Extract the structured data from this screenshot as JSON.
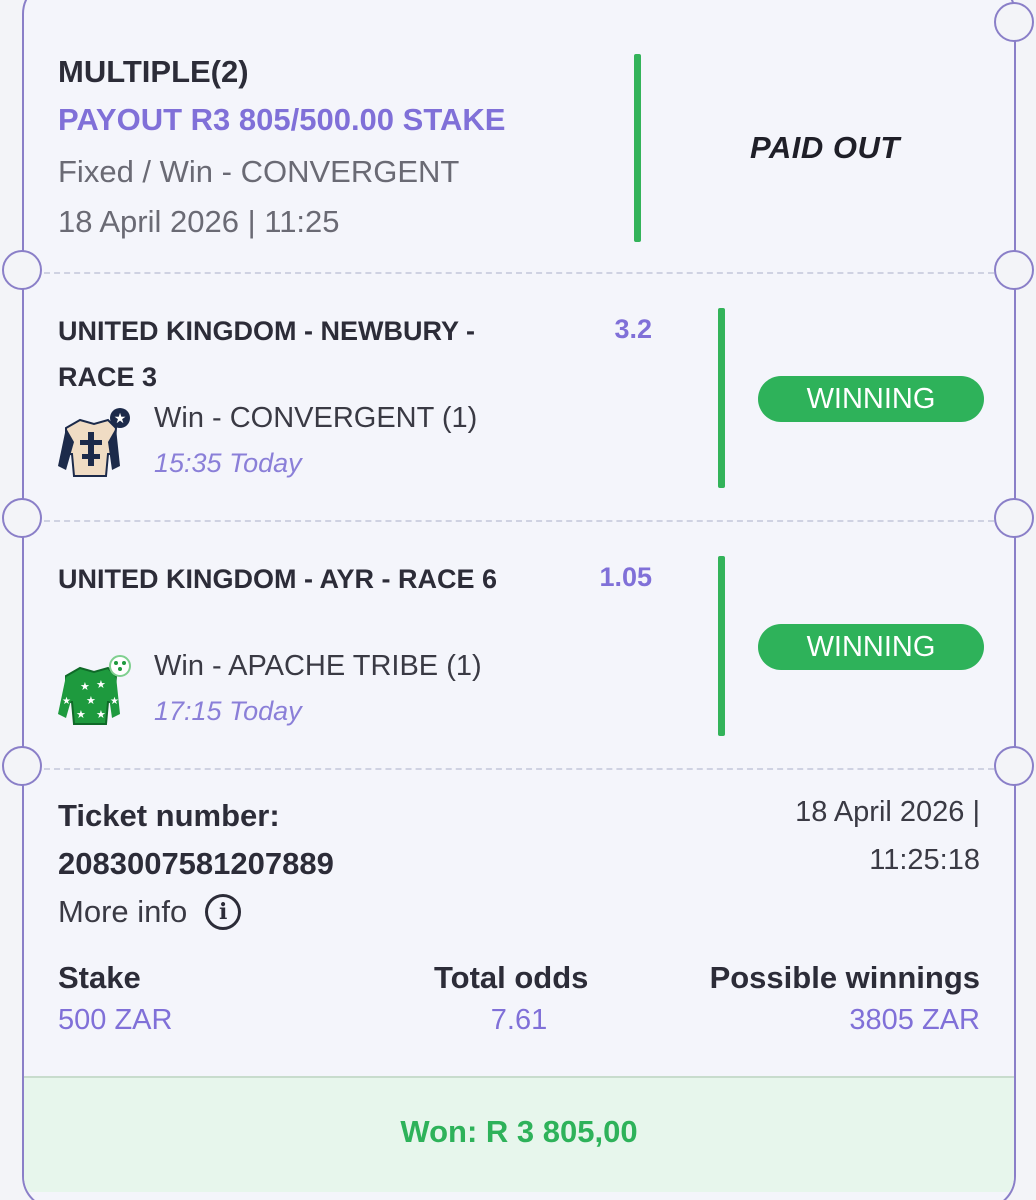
{
  "header": {
    "title": "MULTIPLE(2)",
    "payout": "PAYOUT R3 805/500.00 STAKE",
    "bet_type": "Fixed / Win - CONVERGENT",
    "datetime": "18 April 2026 | 11:25",
    "status": "PAID OUT"
  },
  "legs": [
    {
      "race": "UNITED KINGDOM - NEWBURY - RACE 3",
      "odds": "3.2",
      "selection": "Win - CONVERGENT (1)",
      "time": "15:35 Today",
      "status": "WINNING",
      "silk_icon": "jockey-silk-cream-navy-icon"
    },
    {
      "race": "UNITED KINGDOM - AYR - RACE 6",
      "odds": "1.05",
      "selection": "Win - APACHE TRIBE (1)",
      "time": "17:15 Today",
      "status": "WINNING",
      "silk_icon": "jockey-silk-green-stars-icon"
    }
  ],
  "ticket": {
    "number_label": "Ticket number:",
    "number": "2083007581207889",
    "more_info": "More info",
    "date_line1": "18 April 2026 |",
    "date_line2": "11:25:18"
  },
  "summary": {
    "stake_label": "Stake",
    "stake_value": "500 ZAR",
    "odds_label": "Total odds",
    "odds_value": "7.61",
    "winnings_label": "Possible winnings",
    "winnings_value": "3805 ZAR"
  },
  "footer": {
    "won": "Won: R 3 805,00"
  },
  "colors": {
    "accent": "#8070d8",
    "success": "#2eb25a",
    "border": "#8a7fc8"
  }
}
